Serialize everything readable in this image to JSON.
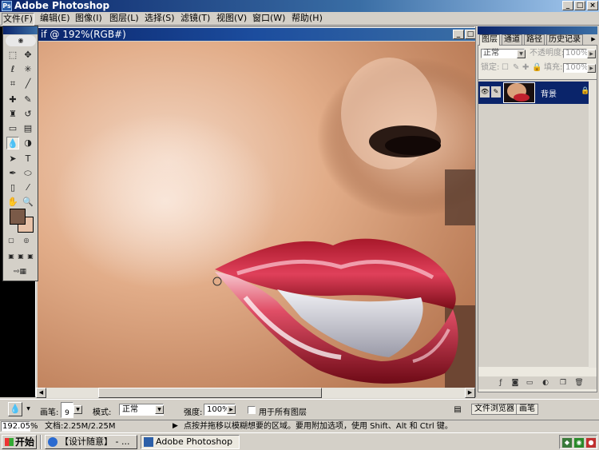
{
  "app": {
    "title": "Adobe Photoshop",
    "icon": "ps-icon"
  },
  "window_controls": [
    "_",
    "□",
    "×"
  ],
  "menu": [
    "文件(F)",
    "编辑(E)",
    "图像(I)",
    "图层(L)",
    "选择(S)",
    "滤镜(T)",
    "视图(V)",
    "窗口(W)",
    "帮助(H)"
  ],
  "document": {
    "title": "if @ 192%(RGB#)",
    "controls": [
      "_",
      "□"
    ]
  },
  "panel": {
    "tabs": [
      "图层",
      "通道",
      "路径",
      "历史记录"
    ],
    "blend_mode": "正常",
    "opacity_label": "不透明度:",
    "opacity_value": "100%",
    "lock_label": "锁定:",
    "fill_label": "填充:",
    "fill_value": "100%",
    "layer": {
      "name": "背景",
      "lock_icon": "lock-icon"
    },
    "bottom_tabs": [
      "文件浏览器",
      "画笔"
    ]
  },
  "options": {
    "brush_label": "画笔:",
    "brush_size": "9",
    "mode_label": "模式:",
    "mode_value": "正常",
    "strength_label": "强度:",
    "strength_value": "100%",
    "all_layers_label": "用于所有图层"
  },
  "status": {
    "zoom": "192.05%",
    "doc_size": "文档:2.25M/2.25M",
    "hint": "点按并拖移以模糊想要的区域。要用附加选项，使用 Shift、Alt 和 Ctrl 键。"
  },
  "taskbar": {
    "start": "开始",
    "buttons": [
      "【设计随意】 - ...",
      "Adobe Photoshop"
    ]
  },
  "colors": {
    "foreground": "#7a5a48",
    "background": "#e8c2a8",
    "titlebar": "#0a246a",
    "lip_red": "#c0202e"
  }
}
